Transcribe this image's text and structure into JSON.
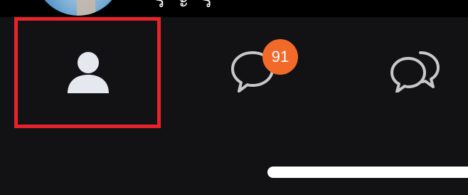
{
  "status_bar": {
    "partial_text": "ร ะ ร"
  },
  "bottom_nav": {
    "items": [
      {
        "id": "profile",
        "icon": "person-icon",
        "selected": true
      },
      {
        "id": "messages",
        "icon": "chat-bubble-icon",
        "badge": "91"
      },
      {
        "id": "groups",
        "icon": "group-chat-icon"
      }
    ]
  },
  "colors": {
    "background": "#121214",
    "top_strip": "#000000",
    "selection_border": "#e8222b",
    "badge": "#f26a2a",
    "icon_filled": "#e6e8f0",
    "icon_outline": "#c8c8c8",
    "home_indicator": "#ffffff"
  }
}
